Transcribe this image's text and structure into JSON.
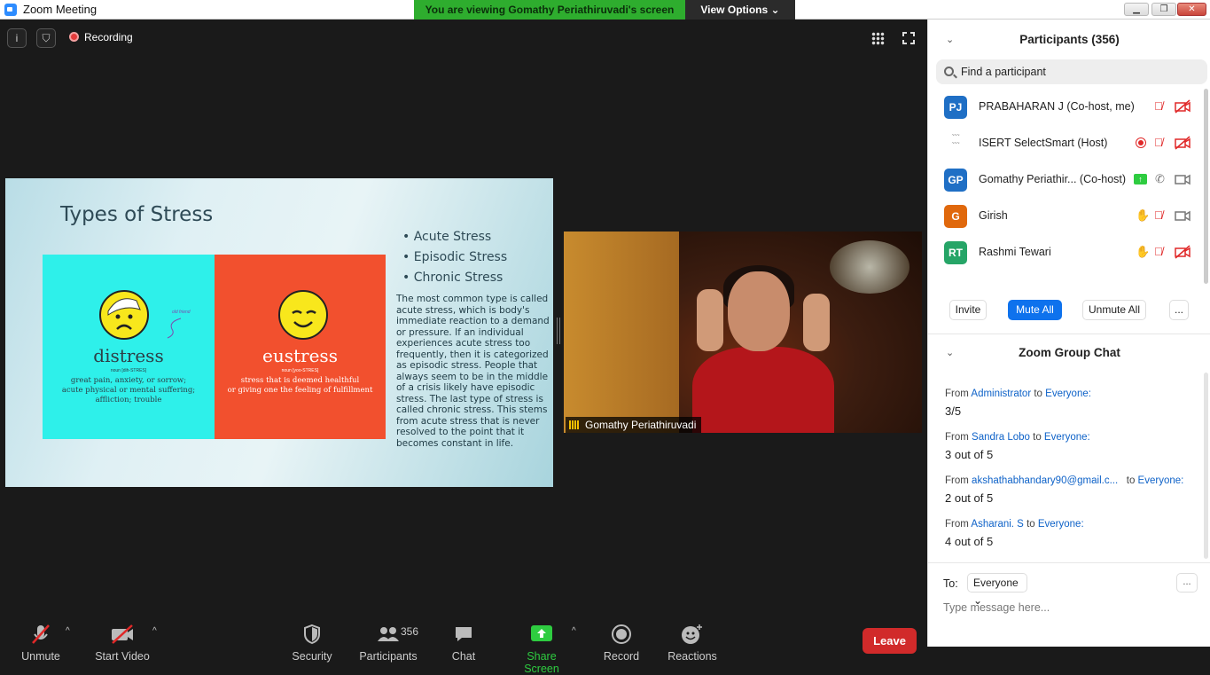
{
  "window": {
    "title": "Zoom Meeting",
    "banner": "You are viewing Gomathy Periathiruvadi's screen",
    "view_options": "View Options",
    "minimize_icon": "minimize-icon",
    "maximize_icon": "maximize-icon",
    "close_icon": "close-icon"
  },
  "meeting": {
    "recording_label": "Recording",
    "info_icon": "info-icon",
    "shield_icon": "shield-icon",
    "grid_icon": "grid-icon",
    "fullscreen_icon": "fullscreen-icon"
  },
  "slide": {
    "title": "Types of Stress",
    "distress": {
      "word": "distress",
      "pron": "noun [dih-STRES]",
      "def1": "great pain, anxiety, or sorrow;",
      "def2": "acute physical or mental suffering;",
      "def3": "affliction; trouble",
      "note": "old friend"
    },
    "eustress": {
      "word": "eustress",
      "pron": "noun [yoo-STRES]",
      "def1": "stress that is deemed healthful",
      "def2": "or giving one the feeling of fulfillment"
    },
    "bullets": [
      "Acute Stress",
      "Episodic Stress",
      "Chronic Stress"
    ],
    "body": "The most common type is called acute stress, which is body's immediate reaction to a demand or pressure.  If an individual experiences acute stress too frequently, then it is categorized as episodic stress.  People that always seem to be in the middle of a crisis likely have episodic stress.  The last type of stress is called chronic stress.  This stems from acute stress that is never resolved to the point that it becomes constant in life."
  },
  "video": {
    "name": "Gomathy Periathiruvadi"
  },
  "toolbar": {
    "unmute": "Unmute",
    "start_video": "Start Video",
    "security": "Security",
    "participants": "Participants",
    "participants_count": "356",
    "chat": "Chat",
    "share_screen": "Share Screen",
    "record": "Record",
    "reactions": "Reactions",
    "leave": "Leave"
  },
  "participants": {
    "title": "Participants (356)",
    "search_placeholder": "Find a participant",
    "rows": [
      {
        "initials": "PJ",
        "color": "#1f6fc5",
        "name": "PRABAHARAN J (Co-host, me)"
      },
      {
        "initials": "",
        "color": "#ffffff",
        "name": "ISERT SelectSmart (Host)"
      },
      {
        "initials": "GP",
        "color": "#1f6fc5",
        "name": "Gomathy Periathir... (Co-host)"
      },
      {
        "initials": "G",
        "color": "#e0680c",
        "name": "Girish"
      },
      {
        "initials": "RT",
        "color": "#26a567",
        "name": "Rashmi Tewari"
      }
    ],
    "invite": "Invite",
    "mute_all": "Mute All",
    "unmute_all": "Unmute All",
    "more": "..."
  },
  "chat": {
    "title": "Zoom Group Chat",
    "messages": [
      {
        "from_word": "From",
        "sender": "Administrator",
        "to_word": "to",
        "to": "Everyone:",
        "text": "3/5"
      },
      {
        "from_word": "From",
        "sender": "Sandra Lobo",
        "to_word": "to",
        "to": "Everyone:",
        "text": "3 out of 5"
      },
      {
        "from_word": "From",
        "sender": "akshathabhandary90@gmail.c...",
        "to_word": "to",
        "to": "Everyone:",
        "text": "2 out of 5"
      },
      {
        "from_word": "From",
        "sender": "Asharani. S",
        "to_word": "to",
        "to": "Everyone:",
        "text": "4 out of 5"
      }
    ],
    "to_label": "To:",
    "to_value": "Everyone",
    "more": "...",
    "placeholder": "Type message here..."
  }
}
